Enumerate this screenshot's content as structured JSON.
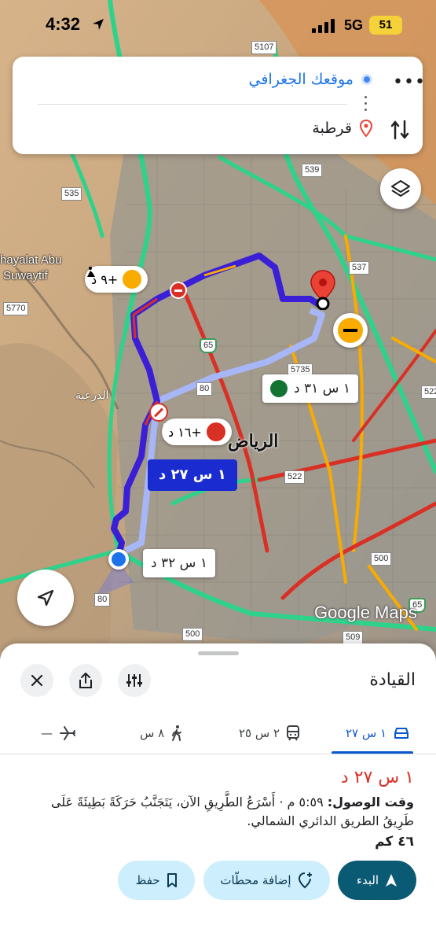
{
  "status_bar": {
    "time": "4:32",
    "network": "5G",
    "battery": "51"
  },
  "search": {
    "origin": "موقعك الجغرافي",
    "destination": "قرطبة"
  },
  "map": {
    "labels": {
      "city": "الرياض",
      "district": "الدرعية",
      "place_line1": "hayalat Abu",
      "place_line2": "Suwaytif"
    },
    "shields": [
      "5107",
      "539",
      "535",
      "537",
      "5770",
      "65",
      "5735",
      "80",
      "522",
      "522",
      "500",
      "80",
      "500",
      "509",
      "65"
    ],
    "route_alternatives": [
      {
        "label": "١ س ٣١ د"
      },
      {
        "label": "١ س ٢٧ د"
      },
      {
        "label": "١ س ٣٢ د"
      }
    ],
    "incidents": [
      {
        "label": "+٩ د"
      },
      {
        "label": "+١٦ د"
      }
    ],
    "watermark": "Google Maps"
  },
  "sheet": {
    "title": "القيادة",
    "modes": [
      {
        "name": "driving",
        "label": "١ س ٢٧",
        "active": true
      },
      {
        "name": "transit",
        "label": "٢ س ٢٥",
        "active": false
      },
      {
        "name": "walking",
        "label": "٨ س",
        "active": false
      },
      {
        "name": "flight",
        "label": "—",
        "active": false
      }
    ],
    "duration": "١ س ٢٧ د",
    "arrival_label": "وقت الوصول:",
    "arrival_text": "٥:٥٩ م · أَسْرَعُ الطَّرِيقِ الآن، يَتَجَنَّبُ حَرَكَةً بَطِيئَةً عَلَى طَرِيقُ الطريق الدائري الشمالي.",
    "distance": "٤٦ كم",
    "actions": {
      "start": "البدء",
      "add_stops": "إضافة محطّات",
      "save": "حفظ"
    }
  },
  "colors": {
    "accent": "#1a73e8",
    "route_selected": "#3a1fd6",
    "route_alt": "#a7b6f7",
    "traffic_red": "#d93025",
    "traffic_yellow": "#f9ab00",
    "traffic_green": "#2fd28b",
    "start_button": "#0b5a73"
  }
}
